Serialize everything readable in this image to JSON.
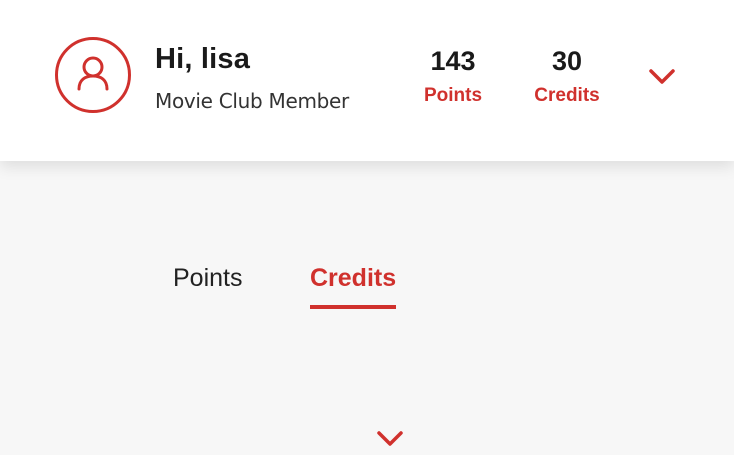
{
  "user": {
    "greeting": "Hi, lisa",
    "membership": "Movie Club Member",
    "avatar_icon": "user-icon"
  },
  "stats": {
    "points": {
      "value": "143",
      "label": "Points"
    },
    "credits": {
      "value": "30",
      "label": "Credits"
    }
  },
  "header": {
    "expand_icon": "chevron-down-icon"
  },
  "tabs": [
    {
      "label": "Points",
      "active": false
    },
    {
      "label": "Credits",
      "active": true
    }
  ],
  "content": {
    "expand_icon": "chevron-down-icon"
  },
  "colors": {
    "accent": "#d0312d",
    "text": "#1a1a1a",
    "background": "#f7f7f7",
    "header_background": "#ffffff"
  }
}
